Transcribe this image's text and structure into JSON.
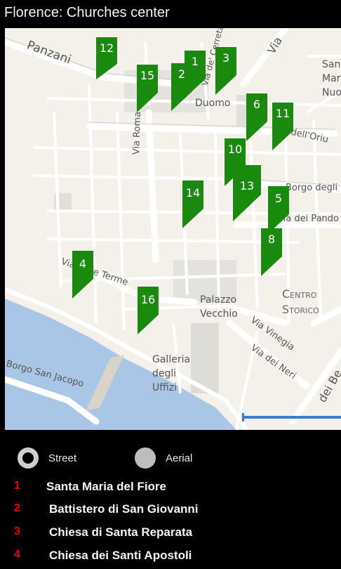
{
  "window": {
    "title": "Florence: Churches center"
  },
  "map": {
    "labels": {
      "panzani": "Panzani",
      "via_roma": "Via Roma",
      "duomo": "Duomo",
      "via_de_cerretani": "Via de' Cerretani",
      "via_dell_oriuolo": "a dell'Oriu",
      "borgo_degli_albizi": "Borgo degli",
      "via_dei_pandolfini": "Via dei Pando",
      "via_terme": "Via delle Terme",
      "palazzo_vecchio": "Palazzo Vecchio",
      "centro_storico": "Centro Storico",
      "via_vinegia": "Via Vinegia",
      "via_dei_neri": "Via dei Neri",
      "galleria_uffizi": "Galleria degli Uffizi",
      "borgo_san_jacopo": "Borgo San Jacopo",
      "san_marco": "San Marco Nuovo",
      "dei_benci": "dei Be",
      "via_top": "Via"
    },
    "markers": [
      {
        "label": "12"
      },
      {
        "label": "15"
      },
      {
        "label": "2"
      },
      {
        "label": "1"
      },
      {
        "label": "3"
      },
      {
        "label": "6"
      },
      {
        "label": "11"
      },
      {
        "label": "10"
      },
      {
        "label": "13"
      },
      {
        "label": "14"
      },
      {
        "label": "5"
      },
      {
        "label": "8"
      },
      {
        "label": "4"
      },
      {
        "label": "16"
      }
    ],
    "marker_color": "#1a8a0e"
  },
  "view_mode": {
    "street_label": "Street",
    "aerial_label": "Aerial",
    "selected": "Street"
  },
  "churches": [
    {
      "num": "1",
      "name": "Santa Maria del Fiore"
    },
    {
      "num": "2",
      "name": "Battistero di San Giovanni"
    },
    {
      "num": "3",
      "name": "Chiesa di Santa Reparata"
    },
    {
      "num": "4",
      "name": "Chiesa dei Santi Apostoli"
    }
  ]
}
